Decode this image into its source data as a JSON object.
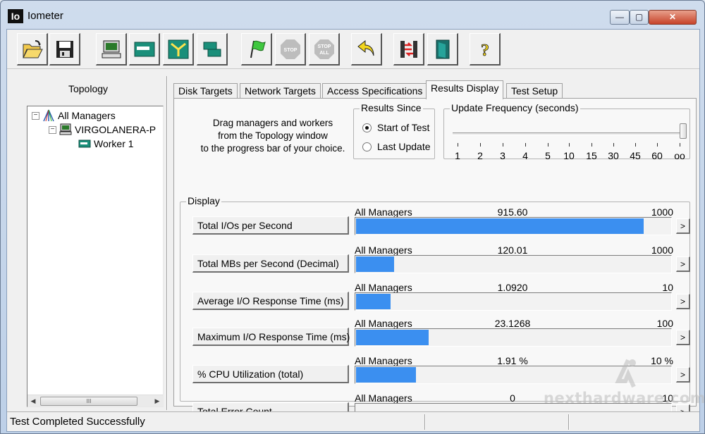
{
  "window": {
    "title": "Iometer",
    "app_icon_text": "Io",
    "min_glyph": "—",
    "max_glyph": "▢",
    "close_glyph": "✕"
  },
  "toolbar": {
    "buttons": [
      {
        "name": "open-config-button",
        "icon": "folder-open-icon"
      },
      {
        "name": "save-config-button",
        "icon": "floppy-disk-icon"
      },
      {
        "name": "new-manager-button",
        "icon": "computer-icon"
      },
      {
        "name": "new-disk-worker-button",
        "icon": "disk-worker-icon"
      },
      {
        "name": "new-network-worker-button",
        "icon": "network-worker-icon"
      },
      {
        "name": "duplicate-worker-button",
        "icon": "duplicate-worker-icon"
      },
      {
        "name": "start-tests-button",
        "icon": "green-flag-icon"
      },
      {
        "name": "stop-test-button",
        "icon": "stop-icon",
        "label": "STOP"
      },
      {
        "name": "stop-all-button",
        "icon": "stop-all-icon",
        "label_top": "STOP",
        "label_bottom": "ALL"
      },
      {
        "name": "reset-workers-button",
        "icon": "reset-arrow-icon"
      },
      {
        "name": "disconnect-managers-button",
        "icon": "exit-managers-icon"
      },
      {
        "name": "exit-button",
        "icon": "exit-door-icon"
      },
      {
        "name": "about-button",
        "icon": "question-mark-icon",
        "label": "?"
      }
    ]
  },
  "topology": {
    "title": "Topology",
    "root": {
      "label": "All Managers",
      "expander": "−"
    },
    "manager": {
      "label": "VIRGOLANERA-P",
      "expander": "−"
    },
    "worker": {
      "label": "Worker 1"
    },
    "scroll_left": "◀",
    "scroll_right": "▶",
    "scroll_thumb": "III"
  },
  "tabs": [
    {
      "label": "Disk Targets",
      "active": false
    },
    {
      "label": "Network Targets",
      "active": false
    },
    {
      "label": "Access Specifications",
      "active": false
    },
    {
      "label": "Results Display",
      "active": true
    },
    {
      "label": "Test Setup",
      "active": false
    }
  ],
  "results": {
    "instructions": [
      "Drag managers and workers",
      "from the Topology window",
      "to the progress bar of your choice."
    ],
    "results_since": {
      "legend": "Results Since",
      "options": [
        {
          "label": "Start of Test",
          "selected": true
        },
        {
          "label": "Last Update",
          "selected": false
        }
      ]
    },
    "update_frequency": {
      "legend": "Update Frequency (seconds)",
      "ticks": [
        "1",
        "2",
        "3",
        "4",
        "5",
        "10",
        "15",
        "30",
        "45",
        "60",
        "oo"
      ],
      "selected": "oo"
    },
    "display": {
      "legend": "Display",
      "rows": [
        {
          "label": "Total I/Os per Second",
          "scope": "All Managers",
          "value": "915.60",
          "max": "1000",
          "fraction": 0.9156
        },
        {
          "label": "Total MBs per Second (Decimal)",
          "scope": "All Managers",
          "value": "120.01",
          "max": "1000",
          "fraction": 0.12
        },
        {
          "label": "Average I/O Response Time (ms)",
          "scope": "All Managers",
          "value": "1.0920",
          "max": "10",
          "fraction": 0.1092
        },
        {
          "label": "Maximum I/O Response Time (ms)",
          "scope": "All Managers",
          "value": "23.1268",
          "max": "100",
          "fraction": 0.2313
        },
        {
          "label": "% CPU Utilization (total)",
          "scope": "All Managers",
          "value": "1.91 %",
          "max": "10 %",
          "fraction": 0.191
        },
        {
          "label": "Total Error Count",
          "scope": "All Managers",
          "value": "0",
          "max": "10",
          "fraction": 0
        }
      ],
      "arrow_glyph": ">",
      "bar_color": "#3b8ff0"
    }
  },
  "status": {
    "text": "Test Completed Successfully"
  },
  "watermark": {
    "text": "nexthardware.com"
  }
}
